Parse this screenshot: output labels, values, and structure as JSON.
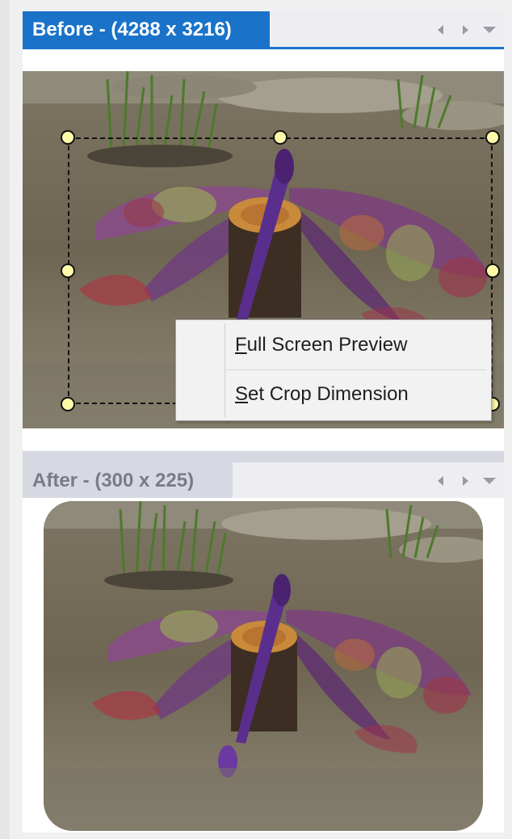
{
  "before_pane": {
    "title": "Before - (4288 x 3216)",
    "nav": [
      "nav-prev",
      "nav-next",
      "dropdown"
    ]
  },
  "after_pane": {
    "title": "After - (300 x 225)"
  },
  "context_menu": {
    "items": [
      {
        "label": "Full Screen Preview",
        "accelerator": "F"
      },
      {
        "label": "Set Crop Dimension",
        "accelerator": "S"
      }
    ]
  },
  "colors": {
    "accent": "#1a73c9",
    "handle_fill": "#fffaa8",
    "inactive_header": "#d7d9e2"
  },
  "icons": {
    "prev": "left-arrow-icon",
    "next": "right-arrow-icon",
    "menu": "dropdown-arrow-icon"
  }
}
